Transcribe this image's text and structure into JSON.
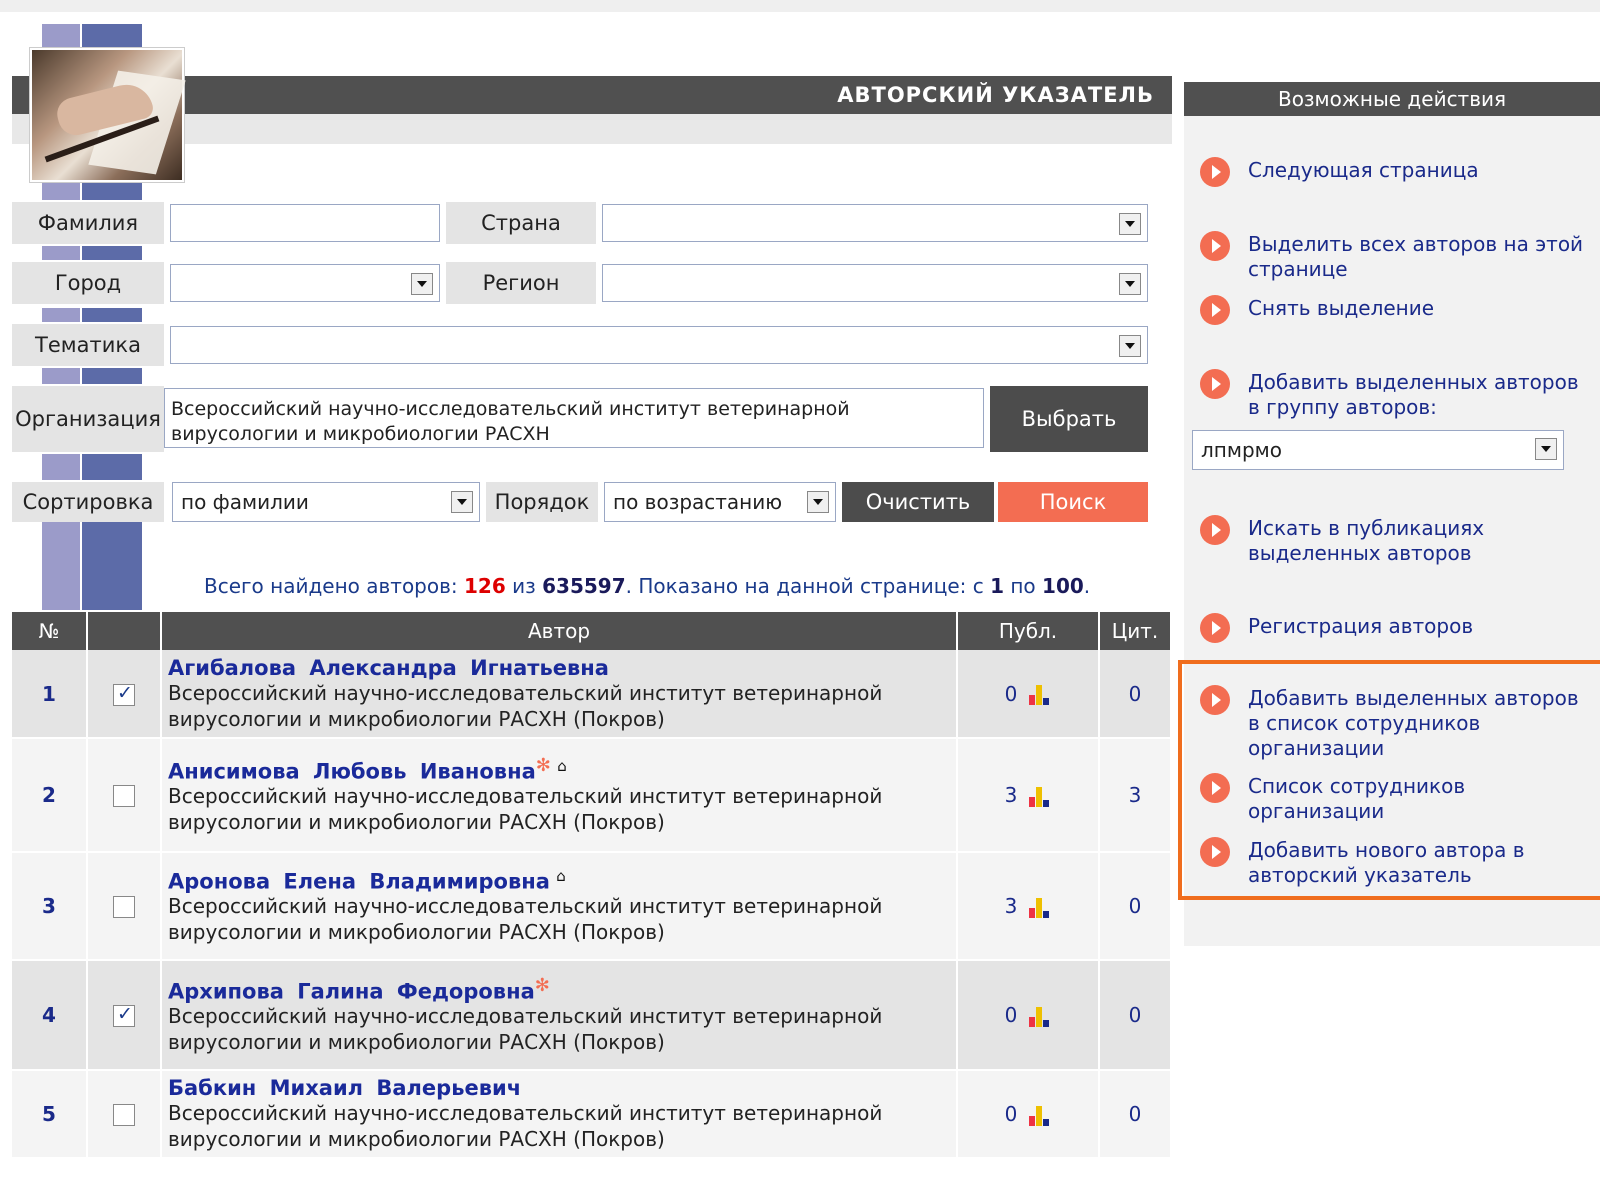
{
  "header": {
    "title": "АВТОРСКИЙ УКАЗАТЕЛЬ"
  },
  "form": {
    "surname_label": "Фамилия",
    "surname_value": "",
    "country_label": "Страна",
    "country_value": "",
    "city_label": "Город",
    "city_value": "",
    "region_label": "Регион",
    "region_value": "",
    "topic_label": "Тематика",
    "topic_value": "",
    "org_label": "Организация",
    "org_value": "Всероссийский научно-исследовательский институт ветеринарной вирусологии и микробиологии РАСХН",
    "choose_button": "Выбрать",
    "sort_label": "Сортировка",
    "sort_value": "по фамилии",
    "order_label": "Порядок",
    "order_value": "по возрастанию",
    "clear_button": "Очистить",
    "search_button": "Поиск"
  },
  "summary": {
    "found_prefix": "Всего найдено авторов:",
    "found_count": "126",
    "of_word": "из",
    "total_count": "635597",
    "shown_prefix": ". Показано на данной странице: с",
    "shown_from": "1",
    "to_word": "по",
    "shown_to": "100",
    "suffix": "."
  },
  "table": {
    "headers": {
      "num": "№",
      "author": "Автор",
      "pubs": "Публ.",
      "cits": "Цит."
    },
    "rows": [
      {
        "num": "1",
        "selected": true,
        "name": "Агибалова Александра Игнатьевна",
        "star": false,
        "house": false,
        "org1": "Всероссийский научно-исследовательский институт ветеринарной",
        "org2": "вирусологии и микробиологии РАСХН (Покров)",
        "pubs": "0",
        "cits": "0"
      },
      {
        "num": "2",
        "selected": false,
        "name": "Анисимова Любовь Ивановна",
        "star": true,
        "house": true,
        "org1": "Всероссийский научно-исследовательский институт ветеринарной",
        "org2": "вирусологии и микробиологии РАСХН (Покров)",
        "pubs": "3",
        "cits": "3"
      },
      {
        "num": "3",
        "selected": false,
        "name": "Аронова Елена Владимировна",
        "star": false,
        "house": true,
        "org1": "Всероссийский научно-исследовательский институт ветеринарной",
        "org2": "вирусологии и микробиологии РАСХН (Покров)",
        "pubs": "3",
        "cits": "0"
      },
      {
        "num": "4",
        "selected": true,
        "name": "Архипова Галина Федоровна",
        "star": true,
        "house": false,
        "org1": "Всероссийский научно-исследовательский институт ветеринарной",
        "org2": "вирусологии и микробиологии РАСХН (Покров)",
        "pubs": "0",
        "cits": "0"
      },
      {
        "num": "5",
        "selected": false,
        "name": "Бабкин Михаил Валерьевич",
        "star": false,
        "house": false,
        "org1": "Всероссийский научно-исследовательский институт ветеринарной",
        "org2": "вирусологии и микробиологии РАСХН (Покров)",
        "pubs": "0",
        "cits": "0"
      }
    ]
  },
  "actions": {
    "title": "Возможные действия",
    "next_page": "Следующая страница",
    "select_all_1": "Выделить всех авторов на этой",
    "select_all_2": "странице",
    "deselect": "Снять выделение",
    "add_group_1": "Добавить выделенных авторов",
    "add_group_2": "в группу авторов:",
    "group_value": "лпмрмо",
    "search_pubs_1": "Искать в публикациях",
    "search_pubs_2": "выделенных авторов",
    "register": "Регистрация авторов",
    "add_staff_1": "Добавить выделенных авторов",
    "add_staff_2": "в список сотрудников",
    "add_staff_3": "организации",
    "staff_list_1": "Список сотрудников",
    "staff_list_2": "организации",
    "add_new_1": "Добавить нового автора в",
    "add_new_2": "авторский указатель"
  }
}
